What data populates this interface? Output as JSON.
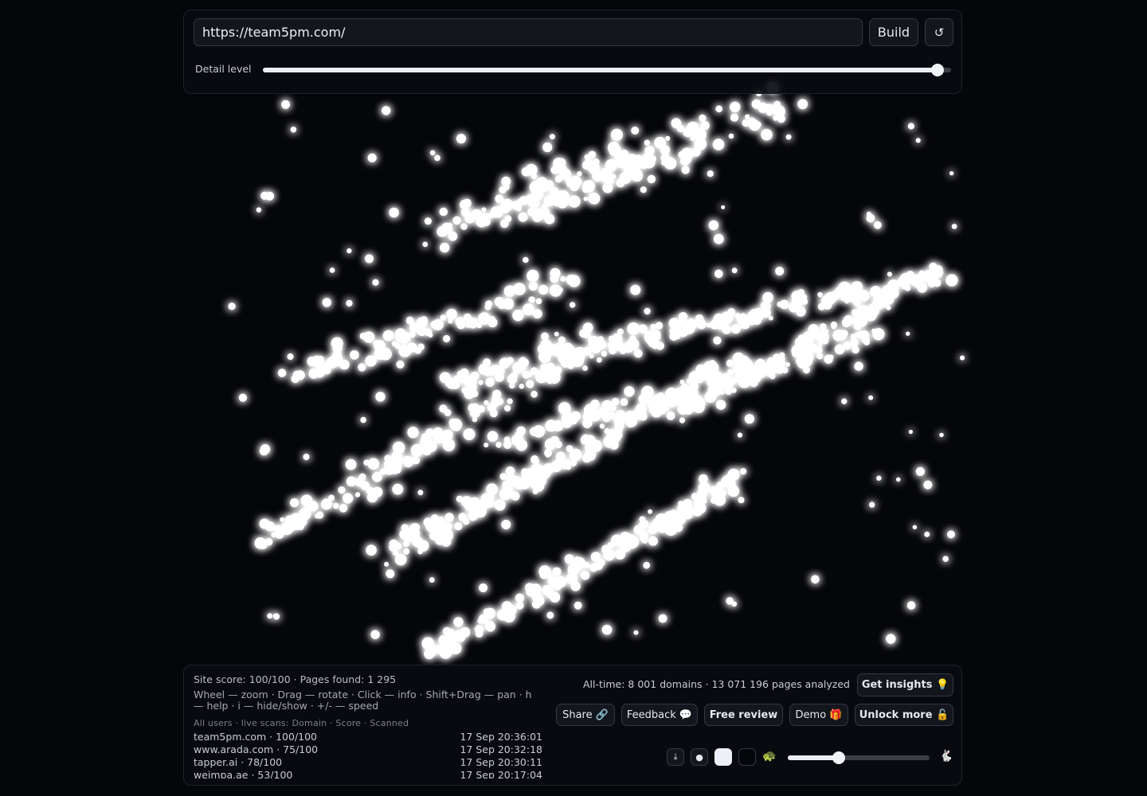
{
  "url_input": {
    "value": "https://team5pm.com/"
  },
  "build_label": "Build",
  "reload_glyph": "↺",
  "detail": {
    "label": "Detail level",
    "level": 0.98
  },
  "visualization": {
    "point_color": "#ffffff",
    "background": "#05060a",
    "glow_color": "#cdd3ff"
  },
  "stats": {
    "score_line": "Site score: 100/100 · Pages found: 1 295",
    "help_text": "Wheel — zoom · Drag — rotate · Click — info · Shift+Drag — pan · h — help · i — hide/show · +/- — speed",
    "feed_header": "All users · live scans: Domain · Score · Scanned",
    "feed": [
      {
        "domain": "team5pm.com · 100/100",
        "time": "17 Sep 20:36:01"
      },
      {
        "domain": "www.arada.com · 75/100",
        "time": "17 Sep 20:32:18"
      },
      {
        "domain": "tapper.ai · 78/100",
        "time": "17 Sep 20:30:11"
      },
      {
        "domain": "weimpa.ae · 53/100",
        "time": "17 Sep 20:17:04"
      }
    ],
    "alltime": "All-time: 8 001 domains · 13 071 196 pages analyzed"
  },
  "buttons": {
    "insights": "Get insights 💡",
    "share": "Share 🔗",
    "feedback": "Feedback 💬",
    "review": "Free review",
    "demo": "Demo 🎁",
    "unlock": "Unlock more 🔓"
  },
  "controls": {
    "download_glyph": "⤓",
    "dot_glyph": "●",
    "turtle_glyph": "🐢",
    "rabbit_glyph": "🐇",
    "speed_level": 0.36
  }
}
